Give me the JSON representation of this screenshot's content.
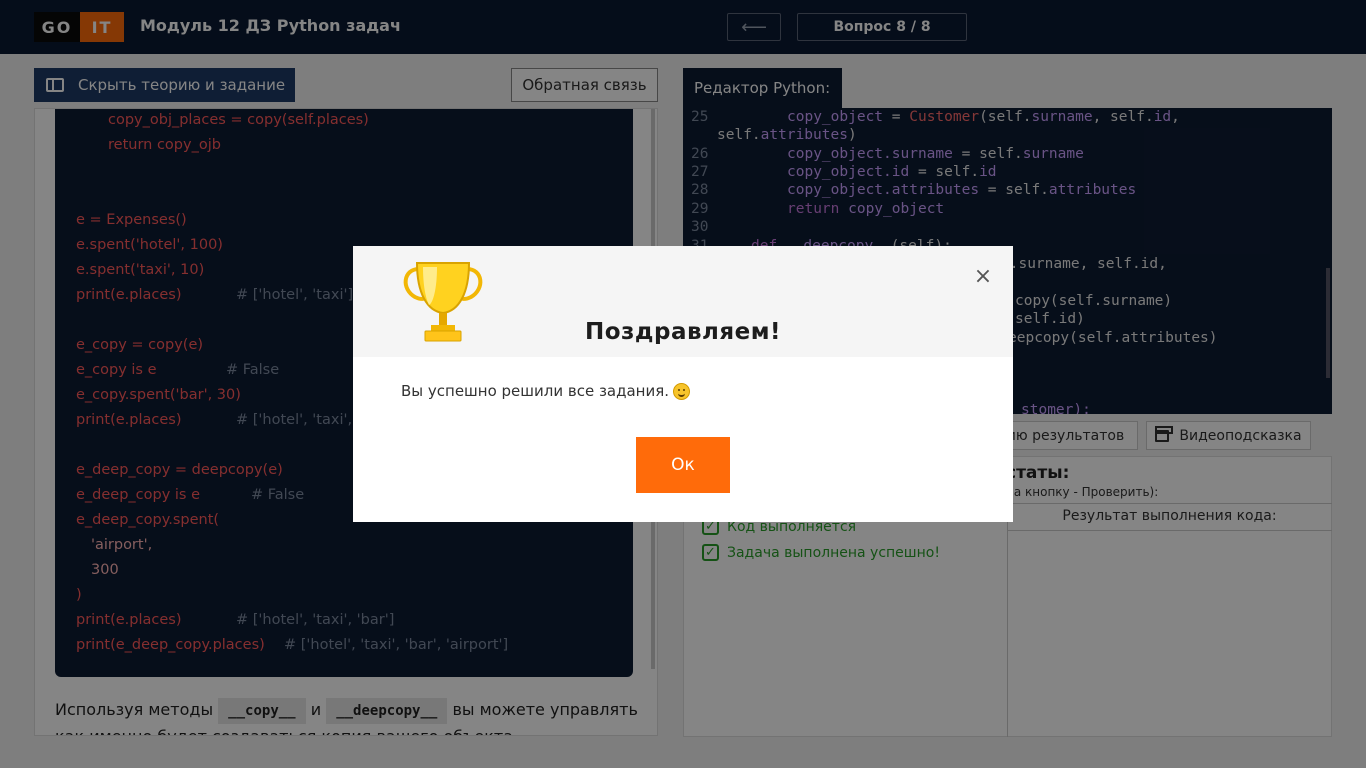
{
  "header": {
    "logo_left": "GO",
    "logo_right": "IT",
    "title": "Модуль 12 ДЗ Python задач",
    "back_symbol": "⟵",
    "question_counter": "Вопрос 8 / 8"
  },
  "left": {
    "hide_button": "Скрыть теорию и задание",
    "feedback_button": "Обратная связь",
    "code_lines": [
      "copy_obj_places = copy(self.places)",
      "return copy_ojb",
      "e = Expenses()",
      "e.spent('hotel', 100)",
      "e.spent('taxi', 10)",
      "print(e.places)",
      "# ['hotel', 'taxi']",
      "e_copy = copy(e)",
      "e_copy is e",
      "# False",
      "e_copy.spent('bar', 30)",
      "print(e.places)",
      "# ['hotel', 'taxi', 'bar']",
      "e_deep_copy = deepcopy(e)",
      "e_deep_copy is e",
      "# False",
      "e_deep_copy.spent(",
      "'airport',",
      "300",
      ")",
      "print(e.places)",
      "# ['hotel', 'taxi', 'bar']",
      "print(e_deep_copy.places)",
      "# ['hotel', 'taxi', 'bar', 'airport']"
    ],
    "para_before": "Используя методы",
    "para_code1": "__copy__",
    "para_and": "и",
    "para_code2": "__deepcopy__",
    "para_after": "вы можете управлять",
    "para_line2": "как именно будет создаваться копия вашего объекта."
  },
  "editor": {
    "tab": "Редактор Python:",
    "line_numbers": [
      "25",
      "26",
      "27",
      "28",
      "29",
      "30",
      "31"
    ],
    "l25a": "copy_object",
    "l25b": " = ",
    "l25c": "Customer",
    "l25d": "(self.",
    "l25e": "surname",
    "l25f": ", self.",
    "l25g": "id",
    "l25h": ",",
    "l25i": "self.",
    "l25j": "attributes",
    "l25k": ")",
    "l26a": "copy_object.",
    "l26b": "surname",
    "l26c": " = self.",
    "l26d": "surname",
    "l27a": "copy_object.",
    "l27b": "id",
    "l27c": " = self.",
    "l27d": "id",
    "l28a": "copy_object.",
    "l28b": "attributes",
    "l28c": " = self.",
    "l28d": "attributes",
    "l29a": "return",
    "l29b": " copy_object",
    "l31a": "def",
    "l31b": " __deepcopy__",
    "l31c": "(self):",
    "frag1": "f.surname, self.id,",
    "frag2": "copy(self.surname)",
    "frag3": "self.id)",
    "frag4": "eepcopy(self.attributes)",
    "frag5": "stomer):"
  },
  "results": {
    "show_results_button": "ию результатов",
    "video_button": "Видеоподсказка",
    "title": "статы:",
    "hint": "на кнопку - Проверить):",
    "code_result_header": "Результат выполнения кода:",
    "checks": [
      "Код выполняется",
      "Задача выполнена успешно!"
    ],
    "check_symbol": "✓"
  },
  "modal": {
    "title": "Поздравляем!",
    "message": "Вы успешно решили все задания.",
    "ok": "Ок",
    "close_symbol": "×"
  },
  "colors": {
    "brand_orange": "#ff6b0a",
    "header_navy": "#0b1a33",
    "success_green": "#2a9d2a"
  }
}
